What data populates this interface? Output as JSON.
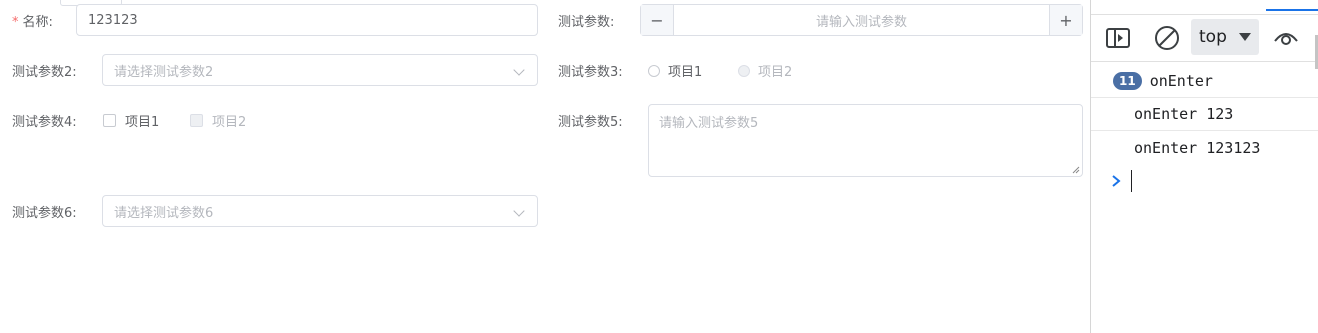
{
  "form": {
    "name": {
      "required_mark": "*",
      "label": "名称:",
      "value": "123123"
    },
    "param1": {
      "label": "测试参数:",
      "placeholder": "请输入测试参数",
      "minus": "−",
      "plus": "+"
    },
    "param2": {
      "label": "测试参数2:",
      "placeholder": "请选择测试参数2"
    },
    "param3": {
      "label": "测试参数3:",
      "options": [
        {
          "label": "项目1",
          "disabled": false
        },
        {
          "label": "项目2",
          "disabled": true
        }
      ]
    },
    "param4": {
      "label": "测试参数4:",
      "options": [
        {
          "label": "项目1",
          "disabled": false
        },
        {
          "label": "项目2",
          "disabled": true
        }
      ]
    },
    "param5": {
      "label": "测试参数5:",
      "placeholder": "请输入测试参数5"
    },
    "param6": {
      "label": "测试参数6:",
      "placeholder": "请选择测试参数6"
    }
  },
  "devtools": {
    "context": "top",
    "logs": [
      {
        "count": "11",
        "text": "onEnter"
      },
      {
        "text": "onEnter 123"
      },
      {
        "text": "onEnter 123123"
      }
    ],
    "prompt_icon": "chevron-right-icon",
    "colors": {
      "accent": "#1a73e8",
      "badge": "#4a6fa5"
    }
  }
}
